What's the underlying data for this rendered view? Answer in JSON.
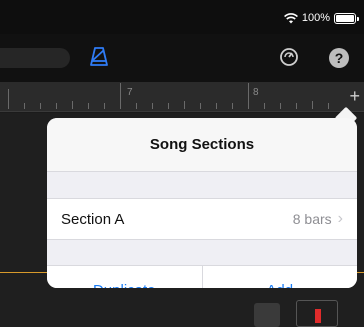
{
  "status_bar": {
    "battery_text": "100%"
  },
  "toolbar": {
    "icons": [
      "metronome-icon",
      "settings-icon",
      "help-icon"
    ],
    "help_label": "?"
  },
  "ruler": {
    "markers": [
      "7",
      "8"
    ],
    "add_label": "+"
  },
  "popover": {
    "title": "Song Sections",
    "sections": [
      {
        "name": "Section A",
        "length": "8 bars"
      }
    ],
    "actions": {
      "duplicate": "Duplicate",
      "add": "Add"
    }
  },
  "colors": {
    "accent_blue": "#1a7cf5",
    "metronome_blue": "#2f7cf6",
    "playhead_orange": "#d79a2b",
    "record_red": "#e02b2b"
  }
}
